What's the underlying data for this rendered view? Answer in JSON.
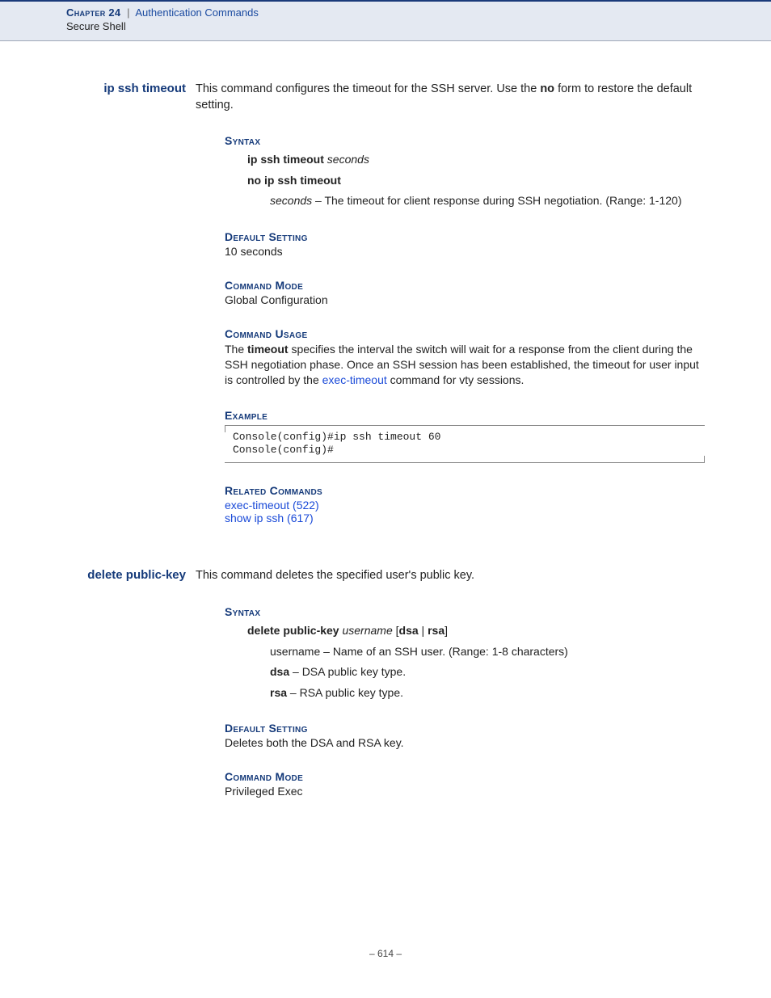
{
  "header": {
    "chapter_label": "Chapter 24",
    "pipe": "|",
    "chapter_title": "Authentication Commands",
    "subsection": "Secure Shell"
  },
  "cmd1": {
    "sidehead": "ip ssh timeout",
    "intro_pre": "This command configures the timeout for the SSH server. Use the ",
    "intro_bold": "no",
    "intro_post": " form to restore the default setting.",
    "syntax_head": "Syntax",
    "syntax_l1_b": "ip ssh timeout",
    "syntax_l1_i": "seconds",
    "syntax_l2": "no ip ssh timeout",
    "param_i": "seconds",
    "param_txt": " – The timeout for client response during SSH negotiation. (Range: 1-120)",
    "default_head": "Default Setting",
    "default_val": "10 seconds",
    "mode_head": "Command Mode",
    "mode_val": "Global Configuration",
    "usage_head": "Command Usage",
    "usage_pre": "The ",
    "usage_b": "timeout",
    "usage_mid": " specifies the interval the switch will wait for a response from the client during the SSH negotiation phase. Once an SSH session has been established, the timeout for user input is controlled by the ",
    "usage_link": "exec-timeout",
    "usage_post": " command for vty sessions.",
    "example_head": "Example",
    "example_code": "Console(config)#ip ssh timeout 60\nConsole(config)#",
    "related_head": "Related Commands",
    "related1": "exec-timeout (522)",
    "related2": "show ip ssh (617)"
  },
  "cmd2": {
    "sidehead": "delete public-key",
    "intro": "This command deletes the specified user's public key.",
    "syntax_head": "Syntax",
    "syntax_b1": "delete public-key",
    "syntax_i": "username",
    "syntax_br_open": " [",
    "syntax_b2": "dsa",
    "syntax_pipe": " | ",
    "syntax_b3": "rsa",
    "syntax_br_close": "]",
    "p1": "username – Name of an SSH user. (Range: 1-8 characters)",
    "p2_b": "dsa",
    "p2_t": " – DSA public key type.",
    "p3_b": "rsa",
    "p3_t": " – RSA public key type.",
    "default_head": "Default Setting",
    "default_val": "Deletes both the DSA and RSA key.",
    "mode_head": "Command Mode",
    "mode_val": "Privileged Exec"
  },
  "page_number": "–  614  –"
}
